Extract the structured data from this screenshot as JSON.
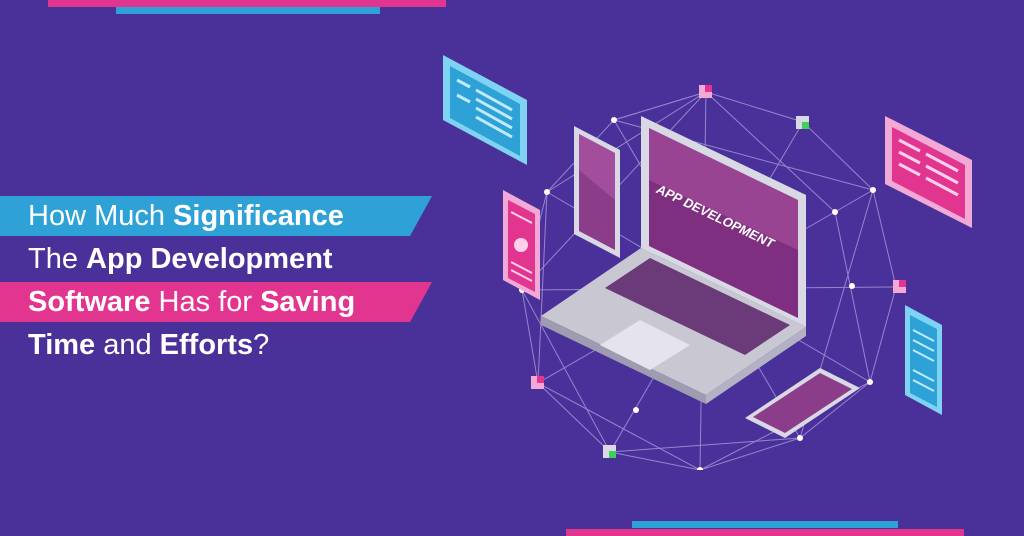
{
  "colors": {
    "background": "#4a3199",
    "accent_blue": "#2ea2d6",
    "accent_pink": "#e2358f",
    "screen_purple": "#8c3d8a",
    "laptop_silver": "#c9c8d2",
    "node_green": "#3bd15b"
  },
  "headline": {
    "line1": {
      "thin": "How Much ",
      "bold": "Significance",
      "band": "blue"
    },
    "line2": {
      "thin": "The ",
      "bold": "App Development",
      "band": "none"
    },
    "line3": {
      "bold": "Software",
      "thin": " Has for ",
      "bold2": "Saving",
      "band": "pink"
    },
    "line4": {
      "bold": "Time",
      "thin": " and ",
      "bold2": "Efforts",
      "thin2": "?",
      "band": "none"
    }
  },
  "illustration": {
    "screen_text": "APP DEVELOPMENT",
    "icons": [
      "laptop-icon",
      "smartphone-icon",
      "tablet-icon",
      "web-card-icon",
      "network-node-icon"
    ]
  }
}
